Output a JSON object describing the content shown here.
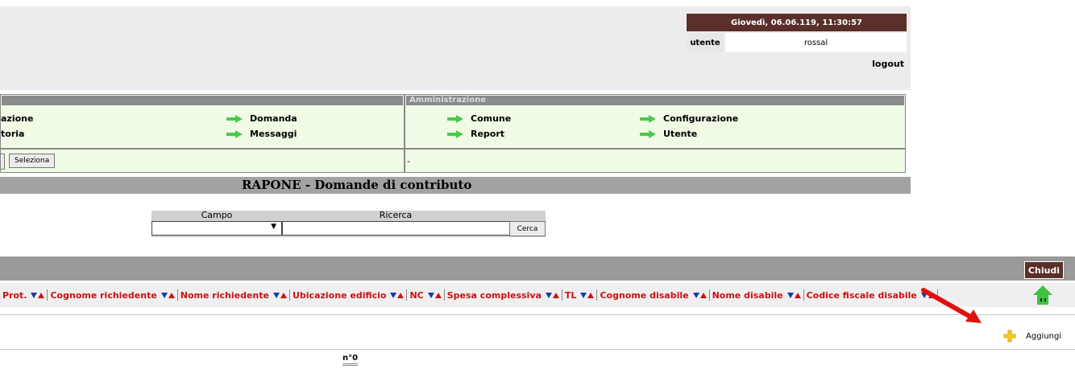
{
  "header": {
    "datetime": "Giovedì, 06.06.119, 11:30:57",
    "user_label": "utente",
    "user_name": "rossal",
    "logout_label": "logout"
  },
  "menu": {
    "left_items": [
      "azione",
      "toria"
    ],
    "left_mid_items": [
      "Domanda",
      "Messaggi"
    ],
    "right_title": "Amministrazione",
    "right_items": [
      "Comune",
      "Report"
    ],
    "right_mid_items": [
      "Configurazione",
      "Utente"
    ],
    "select_button": "Seleziona",
    "right_status": "-"
  },
  "page_title": "RAPONE - Domande di contributo",
  "search": {
    "campo_label": "Campo",
    "ricerca_label": "Ricerca",
    "campo_value": "",
    "ricerca_value": "",
    "cerca_label": "Cerca"
  },
  "grid": {
    "close_label": "Chiudi",
    "columns": [
      "Prot.",
      "Cognome richiedente",
      "Nome richiedente",
      "Ubicazione edificio",
      "NC",
      "Spesa complessiva",
      "TL",
      "Cognome disabile",
      "Nome disabile",
      "Codice fiscale disabile"
    ],
    "add_label": "Aggiungi",
    "count_label": "n°0"
  },
  "colors": {
    "accent_dark": "#5a2f2a",
    "menu_bg": "#f0fbe6",
    "column_text": "#cc1111",
    "arrow_green": "#4cc94c"
  }
}
